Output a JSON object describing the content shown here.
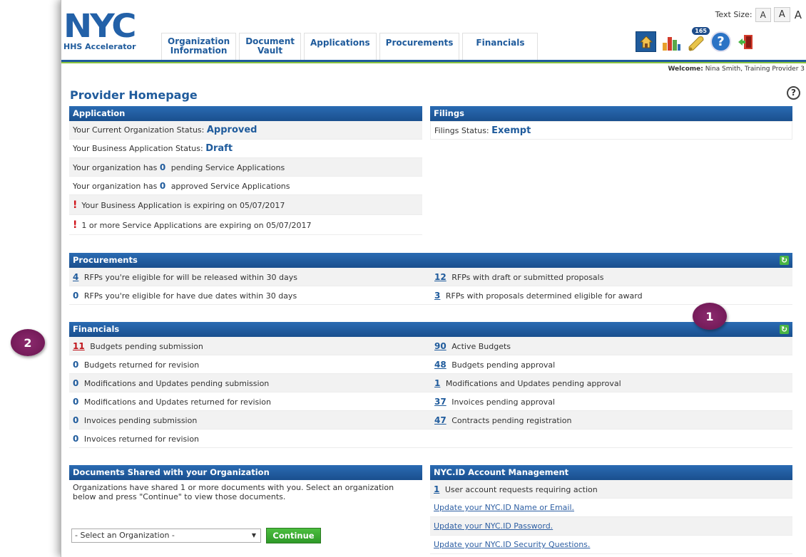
{
  "header": {
    "logo_text": "NYC",
    "logo_sub": "HHS Accelerator",
    "text_size_label": "Text Size:",
    "text_size_options": [
      "A",
      "A",
      "A"
    ],
    "tabs": [
      {
        "line1": "Organization",
        "line2": "Information"
      },
      {
        "line1": "Document",
        "line2": "Vault"
      },
      {
        "line1": "Applications",
        "line2": ""
      },
      {
        "line1": "Procurements",
        "line2": ""
      },
      {
        "line1": "Financials",
        "line2": ""
      }
    ],
    "notifications_count": "165",
    "welcome_label": "Welcome:",
    "welcome_user": "Nina Smith, Training Provider 3"
  },
  "page": {
    "title": "Provider Homepage",
    "help_symbol": "?"
  },
  "application": {
    "title": "Application",
    "org_status_label": "Your Current Organization Status:",
    "org_status_value": "Approved",
    "biz_status_label": "Your Business Application Status:",
    "biz_status_value": "Draft",
    "pending_prefix": "Your organization has",
    "pending_count": "0",
    "pending_suffix": "pending Service Applications",
    "approved_prefix": "Your organization has",
    "approved_count": "0",
    "approved_suffix": "approved Service Applications",
    "warn1": "Your Business Application is expiring on 05/07/2017",
    "warn2": "1 or more Service Applications are expiring on 05/07/2017"
  },
  "filings": {
    "title": "Filings",
    "status_label": "Filings Status:",
    "status_value": "Exempt"
  },
  "procurements": {
    "title": "Procurements",
    "left": [
      {
        "count": "4",
        "text": "RFPs you're eligible for will be released within 30 days",
        "link": true
      },
      {
        "count": "0",
        "text": "RFPs you're eligible for have due dates within 30 days",
        "link": false
      }
    ],
    "right": [
      {
        "count": "12",
        "text": "RFPs with draft or submitted proposals",
        "link": true
      },
      {
        "count": "3",
        "text": "RFPs with proposals determined eligible for award",
        "link": true
      }
    ]
  },
  "financials": {
    "title": "Financials",
    "left": [
      {
        "count": "11",
        "text": "Budgets pending submission",
        "link": true,
        "red": true
      },
      {
        "count": "0",
        "text": "Budgets returned for revision",
        "link": false
      },
      {
        "count": "0",
        "text": "Modifications and Updates pending submission",
        "link": false
      },
      {
        "count": "0",
        "text": "Modifications and Updates returned for revision",
        "link": false
      },
      {
        "count": "0",
        "text": "Invoices pending submission",
        "link": false
      },
      {
        "count": "0",
        "text": "Invoices returned for revision",
        "link": false
      }
    ],
    "right": [
      {
        "count": "90",
        "text": "Active Budgets",
        "link": true
      },
      {
        "count": "48",
        "text": "Budgets pending approval",
        "link": true
      },
      {
        "count": "1",
        "text": "Modifications and Updates pending approval",
        "link": true
      },
      {
        "count": "37",
        "text": "Invoices pending approval",
        "link": true
      },
      {
        "count": "47",
        "text": "Contracts pending registration",
        "link": true
      }
    ]
  },
  "documents": {
    "title": "Documents Shared with your Organization",
    "text": "Organizations have shared 1 or more documents with you. Select an organization below and press \"Continue\" to view those documents.",
    "select_value": "- Select an Organization -",
    "continue_label": "Continue"
  },
  "nycid": {
    "title": "NYC.ID Account Management",
    "requests_count": "1",
    "requests_text": "User account requests requiring action",
    "link1": "Update your NYC.ID Name or Email.",
    "link2": "Update your NYC.ID Password.",
    "link3": "Update your NYC.ID Security Questions."
  },
  "markers": {
    "one": "1",
    "two": "2"
  }
}
